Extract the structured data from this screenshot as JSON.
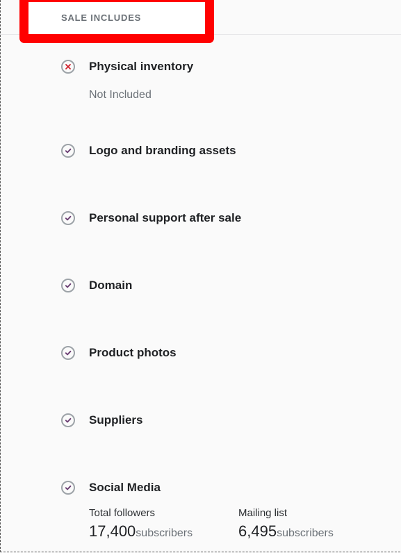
{
  "header": {
    "section_title": "SALE INCLUDES"
  },
  "colors": {
    "highlight_border": "#ff0000",
    "check_mark": "#6b3e73",
    "cross_mark": "#d0222e",
    "icon_ring": "#9da3a8"
  },
  "items": [
    {
      "label": "Physical inventory",
      "icon": "x-circle-icon",
      "note": "Not Included"
    },
    {
      "label": "Logo and branding assets",
      "icon": "check-circle-icon"
    },
    {
      "label": "Personal support after sale",
      "icon": "check-circle-icon"
    },
    {
      "label": "Domain",
      "icon": "check-circle-icon"
    },
    {
      "label": "Product photos",
      "icon": "check-circle-icon"
    },
    {
      "label": "Suppliers",
      "icon": "check-circle-icon"
    },
    {
      "label": "Social Media",
      "icon": "check-circle-icon"
    }
  ],
  "social_media": {
    "total_followers": {
      "label": "Total followers",
      "value": "17,400",
      "unit": "subscribers"
    },
    "mailing_list": {
      "label": "Mailing list",
      "value": "6,495",
      "unit": "subscribers"
    }
  }
}
